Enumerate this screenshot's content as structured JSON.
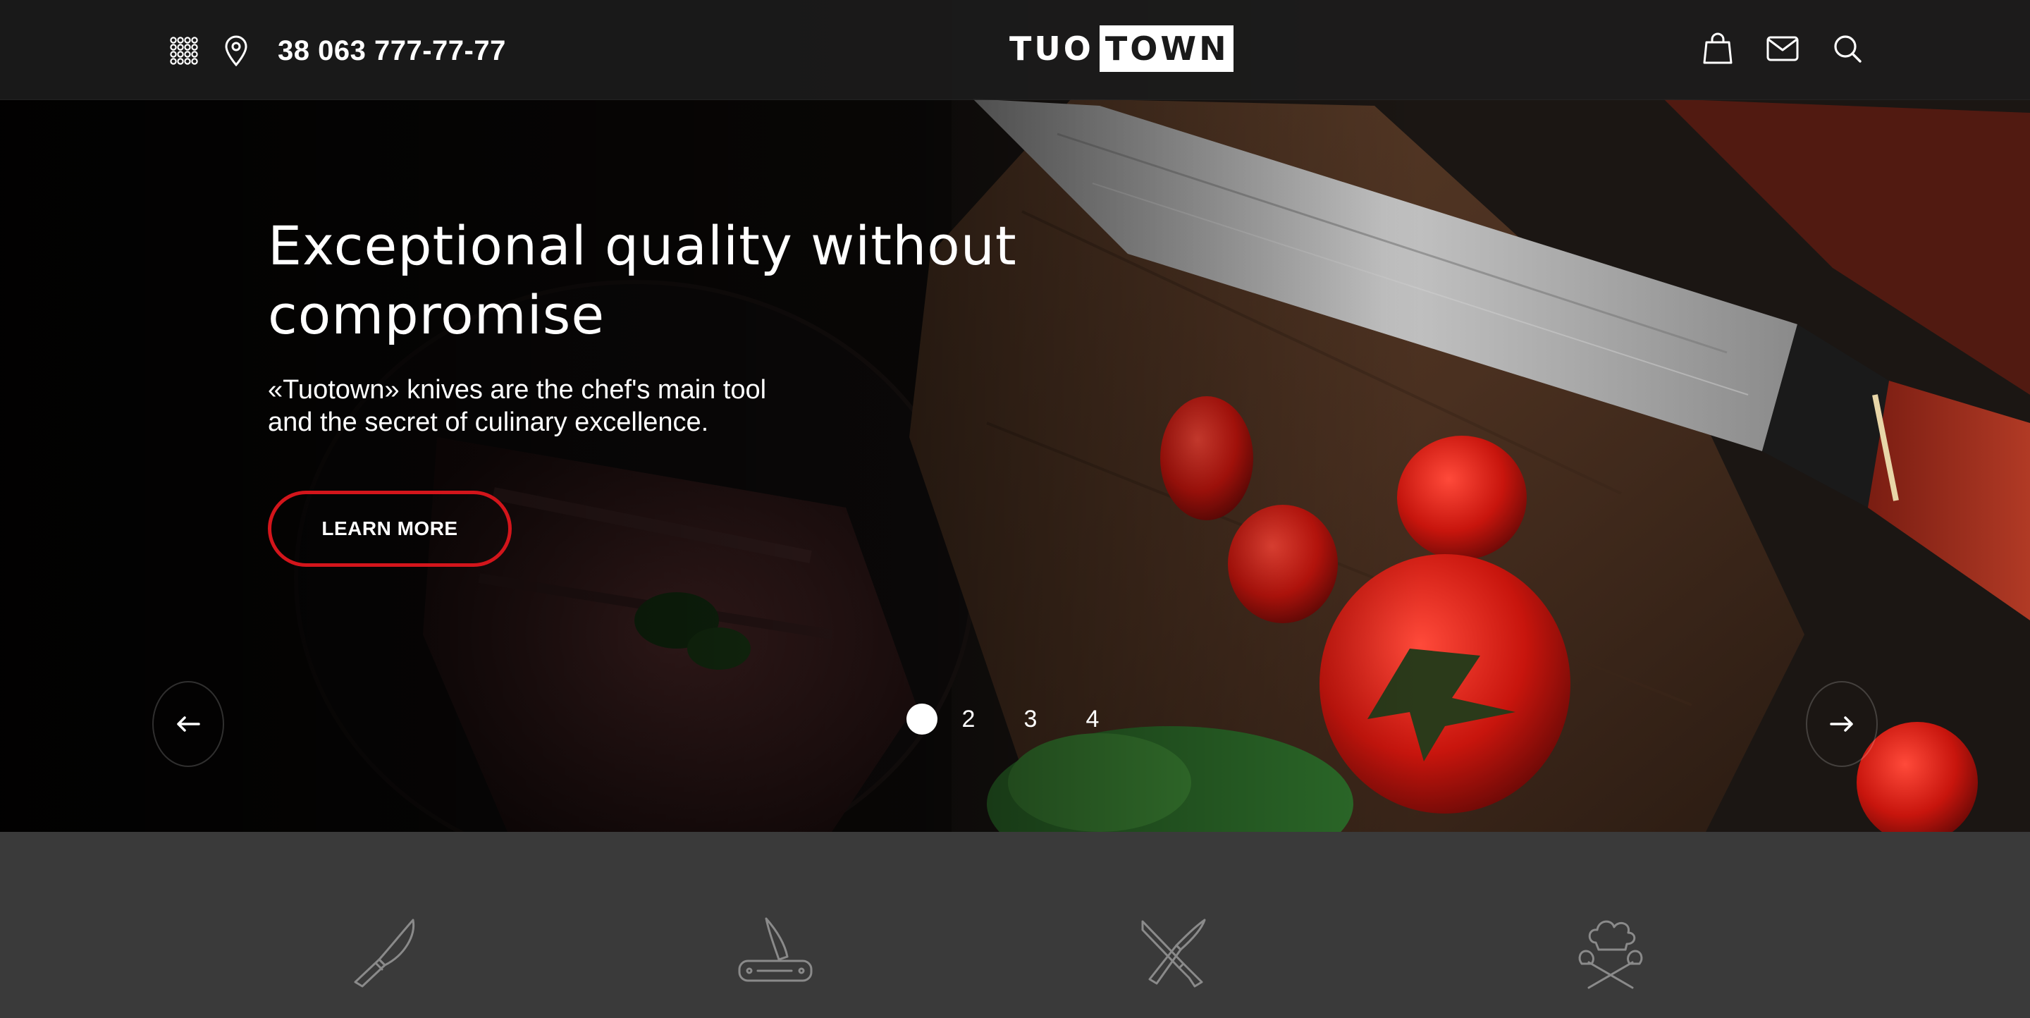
{
  "header": {
    "phone": "38 063 777-77-77",
    "logo_left": "TUO",
    "logo_right": "TOWN",
    "icons": [
      "grid-menu-icon",
      "location-pin-icon",
      "shopping-bag-icon",
      "mail-icon",
      "search-icon"
    ]
  },
  "hero": {
    "title": "Exceptional quality without compromise",
    "subtitle_line1": "«Tuotown» knives are the chef's main tool",
    "subtitle_line2": "and the secret of culinary excellence.",
    "cta_label": "LEARN MORE",
    "slides": [
      "2",
      "3",
      "4"
    ],
    "active_slide": 1
  },
  "categories": {
    "icons": [
      "chef-knife-icon",
      "folding-knife-icon",
      "crossed-knives-icon",
      "chef-hat-utensils-icon"
    ]
  },
  "colors": {
    "accent": "#d3151b",
    "header_bg": "#1c1c1c",
    "strip_bg": "#3a3a3a"
  }
}
